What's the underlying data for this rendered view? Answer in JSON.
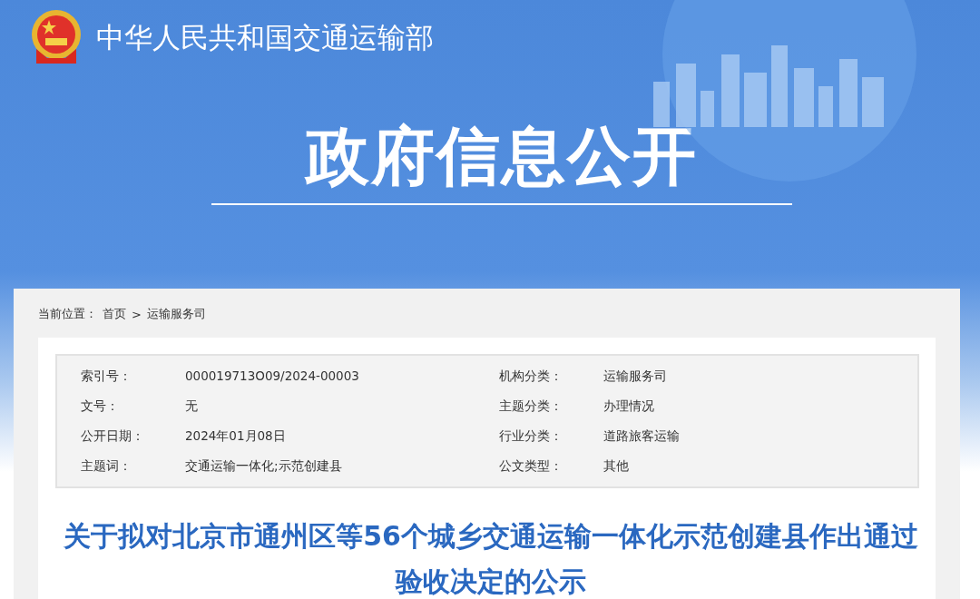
{
  "header": {
    "ministry": "中华人民共和国交通运输部",
    "banner_title": "政府信息公开"
  },
  "breadcrumb": {
    "label": "当前位置：",
    "items": [
      {
        "text": "首页"
      },
      {
        "text": "运输服务司"
      }
    ],
    "separator": ">"
  },
  "info_table": {
    "rows": [
      {
        "left_label": "索引号：",
        "left_value": "000019713O09/2024-00003",
        "right_label": "机构分类：",
        "right_value": "运输服务司"
      },
      {
        "left_label": "文号：",
        "left_value": "无",
        "right_label": "主题分类：",
        "right_value": "办理情况"
      },
      {
        "left_label": "公开日期：",
        "left_value": "2024年01月08日",
        "right_label": "行业分类：",
        "right_value": "道路旅客运输"
      },
      {
        "left_label": "主题词：",
        "left_value": "交通运输一体化;示范创建县",
        "right_label": "公文类型：",
        "right_value": "其他"
      }
    ]
  },
  "article": {
    "title": "关于拟对北京市通州区等56个城乡交通运输一体化示范创建县作出通过验收决定的公示"
  }
}
